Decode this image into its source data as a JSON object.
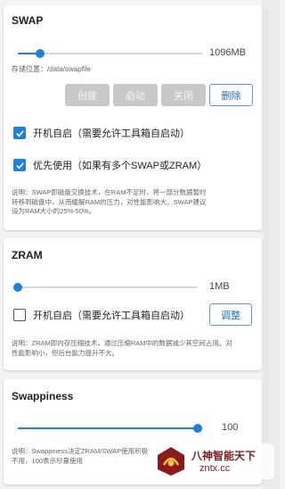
{
  "swap": {
    "title": "SWAP",
    "slider_value": "1096MB",
    "slider_fraction": 0.12,
    "storage_label": "存储位置：/data/swapfile",
    "buttons": {
      "create": "创建",
      "start": "启动",
      "stop": "关闭",
      "delete": "删除"
    },
    "autostart_label": "开机自启（需要允许工具箱自启动）",
    "autostart_checked": true,
    "priority_label": "优先使用（如果有多个SWAP或ZRAM）",
    "priority_checked": true,
    "description_lines": [
      "说明：SWAP即磁盘交换技术，在RAM不足时，将一部分数据暂时",
      "转移到磁盘中，从而缓解RAM的压力，对性能影响大。SWAP建议",
      "设为RAM大小的25%-50%。"
    ]
  },
  "zram": {
    "title": "ZRAM",
    "slider_value": "1MB",
    "slider_fraction": 0.0,
    "autostart_label": "开机自启（需要允许工具箱自启动）",
    "autostart_checked": false,
    "adjust_button": "调整",
    "description_lines": [
      "说明：ZRAM即内存压缩技术，通过压缩RAM中的数据减少其空间占用。对",
      "性能影响小，但后台能力提升不大。"
    ]
  },
  "swappiness": {
    "title": "Swappiness",
    "slider_value": "100",
    "slider_fraction": 1.0,
    "description_lines": [
      "说明：Swappiness决定ZRAM/SWAP使用积极",
      "不用，100表示尽量使用"
    ]
  },
  "watermark": {
    "title": "八神智能天下",
    "url": "zntx.cc"
  },
  "colors": {
    "accent": "#1e80d6",
    "disabled": "#c9c9c9"
  }
}
